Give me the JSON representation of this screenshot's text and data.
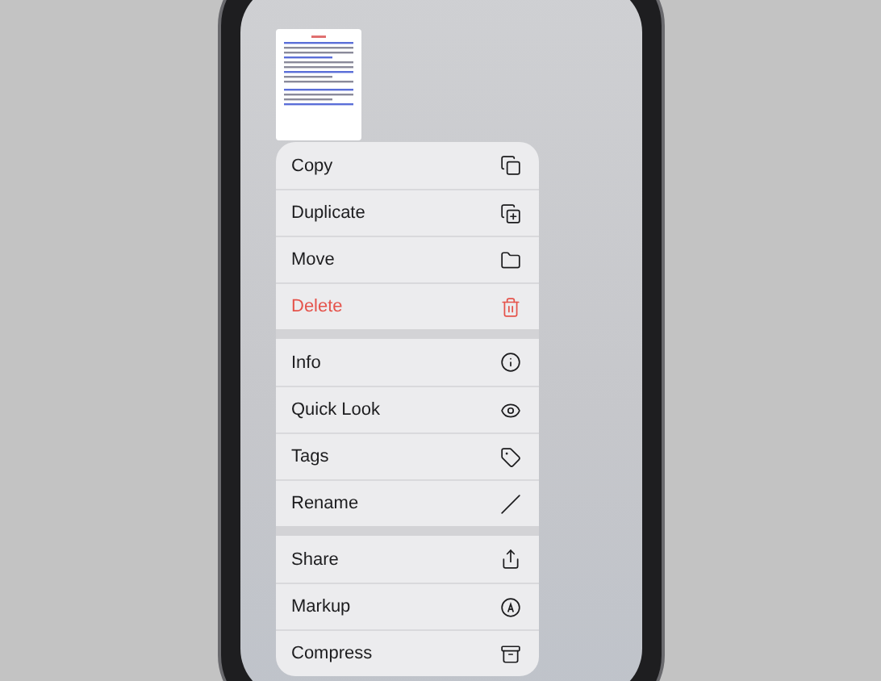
{
  "context_menu": {
    "groups": [
      {
        "items": [
          {
            "label": "Copy",
            "kind": "normal"
          },
          {
            "label": "Duplicate",
            "kind": "normal"
          },
          {
            "label": "Move",
            "kind": "normal"
          },
          {
            "label": "Delete",
            "kind": "destructive"
          }
        ]
      },
      {
        "items": [
          {
            "label": "Info",
            "kind": "normal"
          },
          {
            "label": "Quick Look",
            "kind": "normal"
          },
          {
            "label": "Tags",
            "kind": "normal"
          },
          {
            "label": "Rename",
            "kind": "normal"
          }
        ]
      },
      {
        "items": [
          {
            "label": "Share",
            "kind": "normal"
          },
          {
            "label": "Markup",
            "kind": "normal"
          },
          {
            "label": "Compress",
            "kind": "normal"
          }
        ]
      }
    ]
  }
}
